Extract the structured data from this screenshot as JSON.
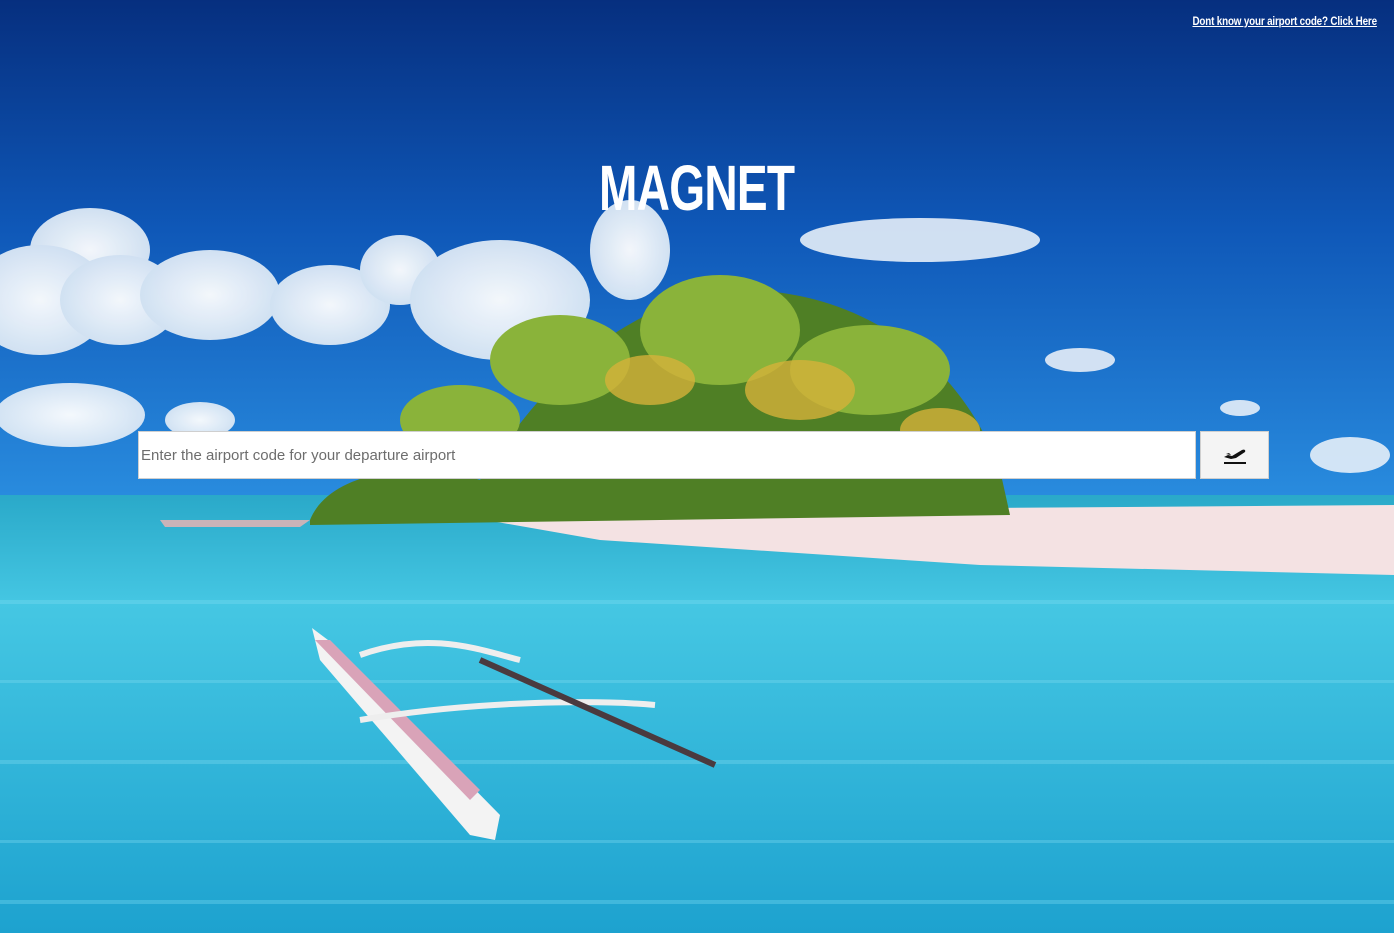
{
  "header": {
    "help_link_label": "Dont know your airport code? Click Here"
  },
  "brand": {
    "title": "MAGNET"
  },
  "search": {
    "placeholder": "Enter the airport code for your departure airport",
    "value": "",
    "button_icon": "airplane-takeoff-icon"
  },
  "background": {
    "icon": "tropical-island-photo",
    "colors": {
      "sky_top": "#0a3a8c",
      "sky_bottom": "#1e7fd6",
      "sea": "#2bb5d8",
      "sand": "#f3e4e2",
      "foliage": "#5c8c2a"
    }
  }
}
